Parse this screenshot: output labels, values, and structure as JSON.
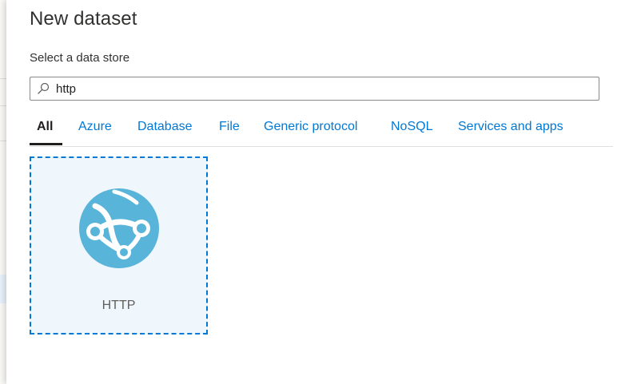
{
  "panel": {
    "title": "New dataset",
    "subtitle": "Select a data store"
  },
  "search": {
    "value": "http",
    "icon": "search-icon"
  },
  "tabs": [
    {
      "label": "All",
      "active": true
    },
    {
      "label": "Azure",
      "active": false
    },
    {
      "label": "Database",
      "active": false
    },
    {
      "label": "File",
      "active": false
    },
    {
      "label": "Generic protocol",
      "active": false
    },
    {
      "label": "NoSQL",
      "active": false
    },
    {
      "label": "Services and apps",
      "active": false
    }
  ],
  "results": [
    {
      "label": "HTTP",
      "icon": "http-globe-icon",
      "selected": true
    }
  ],
  "colors": {
    "accent": "#0078d4",
    "icon_blue": "#59b4d9",
    "tile_bg": "#eff6fc"
  }
}
